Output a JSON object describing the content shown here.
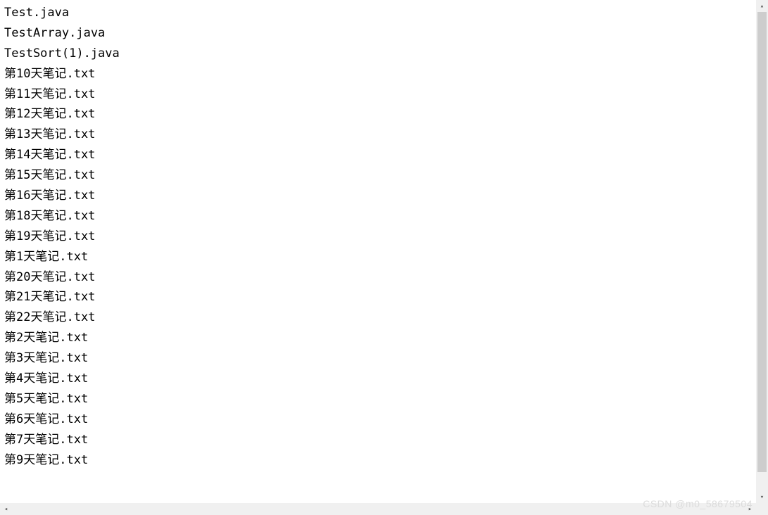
{
  "files": [
    "Test.java",
    "TestArray.java",
    "TestSort(1).java",
    "第10天笔记.txt",
    "第11天笔记.txt",
    "第12天笔记.txt",
    "第13天笔记.txt",
    "第14天笔记.txt",
    "第15天笔记.txt",
    "第16天笔记.txt",
    "第18天笔记.txt",
    "第19天笔记.txt",
    "第1天笔记.txt",
    "第20天笔记.txt",
    "第21天笔记.txt",
    "第22天笔记.txt",
    "第2天笔记.txt",
    "第3天笔记.txt",
    "第4天笔记.txt",
    "第5天笔记.txt",
    "第6天笔记.txt",
    "第7天笔记.txt",
    "第9天笔记.txt"
  ],
  "watermark": "CSDN @m0_58679504",
  "scroll": {
    "up_glyph": "▴",
    "down_glyph": "▾",
    "left_glyph": "◂",
    "right_glyph": "▸"
  }
}
